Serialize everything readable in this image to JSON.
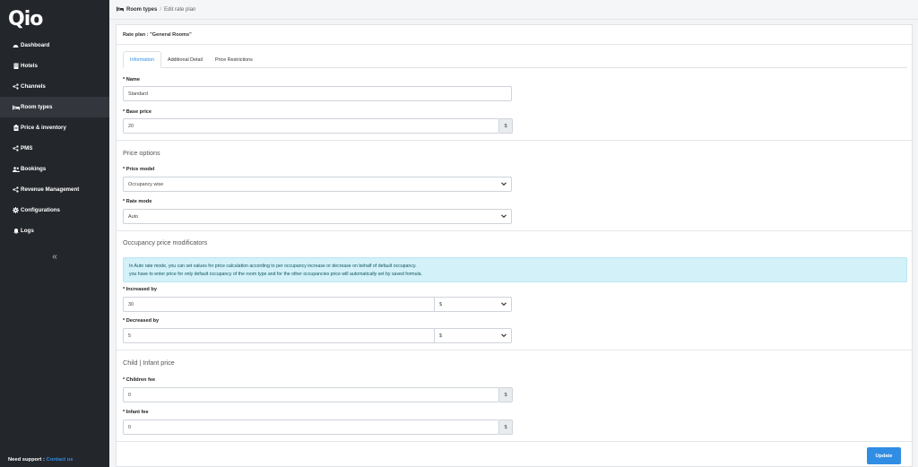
{
  "sidebar": {
    "logo": "Qio",
    "items": [
      {
        "label": "Dashboard",
        "icon": "dashboard-icon"
      },
      {
        "label": "Hotels",
        "icon": "hotel-icon"
      },
      {
        "label": "Channels",
        "icon": "share-icon"
      },
      {
        "label": "Room types",
        "icon": "bed-icon"
      },
      {
        "label": "Price & inventory",
        "icon": "clipboard-icon"
      },
      {
        "label": "PMS",
        "icon": "share-icon"
      },
      {
        "label": "Bookings",
        "icon": "users-icon"
      },
      {
        "label": "Revenue Management",
        "icon": "share-icon"
      },
      {
        "label": "Configurations",
        "icon": "gear-icon"
      },
      {
        "label": "Logs",
        "icon": "bell-icon"
      }
    ],
    "collapse_label": "«",
    "support_label": "Need support :",
    "support_link": "Contact us"
  },
  "breadcrumb": {
    "root": "Room types",
    "separator": "/",
    "current": "Edit rate plan"
  },
  "card": {
    "title": "Rate plan : \"General Rooms\"",
    "tabs": [
      "Information",
      "Additional Detail",
      "Price Restrictions"
    ]
  },
  "form": {
    "name_label": "* Name",
    "name_value": "Standard",
    "base_price_label": "* Base price",
    "base_price_value": "20",
    "currency": "$",
    "price_options_title": "Price options",
    "price_model_label": "* Price model",
    "price_model_value": "Occupancy wise",
    "rate_mode_label": "* Rate mode",
    "rate_mode_value": "Auto",
    "occupancy_title": "Occupancy price modificators",
    "alert_line1": "In Auto rate mode, you can set values for price calculation according to per occupancy increase or decrease on behalf of default occupancy.",
    "alert_line2": "you have to enter price for only default occupancy of the room type and for the other occupancies price will automatically set by saved formula.",
    "increased_label": "* Increased by",
    "increased_value": "30",
    "increased_unit": "$",
    "decreased_label": "* Decreased by",
    "decreased_value": "5",
    "decreased_unit": "$",
    "child_title": "Child | Infant price",
    "children_fee_label": "* Children fee",
    "children_fee_value": "0",
    "infant_fee_label": "* Infant fee",
    "infant_fee_value": "0",
    "update_label": "Update"
  },
  "colors": {
    "sidebar_bg": "#23262b",
    "accent": "#2f8de4",
    "alert_bg": "#d3f1f8"
  }
}
